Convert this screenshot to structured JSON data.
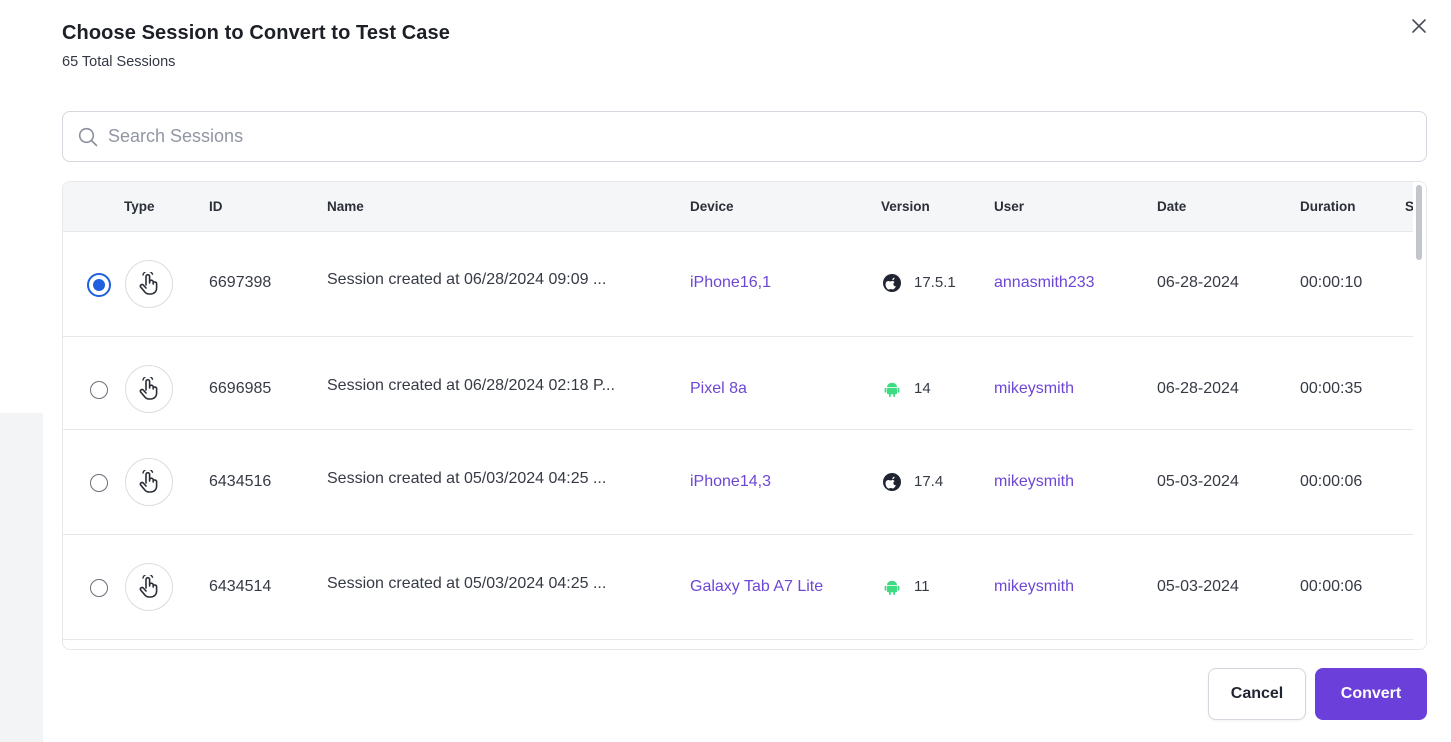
{
  "dialog": {
    "title": "Choose Session to Convert to Test Case",
    "subtitle": "65 Total Sessions"
  },
  "search": {
    "placeholder": "Search Sessions",
    "value": ""
  },
  "table": {
    "columns": [
      "Type",
      "ID",
      "Name",
      "Device",
      "Version",
      "User",
      "Date",
      "Duration",
      "S"
    ],
    "rows": [
      {
        "selected": true,
        "type_icon": "tap-hand-icon",
        "id": "6697398",
        "name": "Session created at 06/28/2024 09:09 ...",
        "device": "iPhone16,1",
        "os": "ios",
        "os_icon": "apple-icon",
        "version": "17.5.1",
        "user": "annasmith233",
        "date": "06-28-2024",
        "duration": "00:00:10"
      },
      {
        "selected": false,
        "type_icon": "tap-hand-icon",
        "id": "6696985",
        "name": "Session created at 06/28/2024 02:18 P...",
        "device": "Pixel 8a",
        "os": "android",
        "os_icon": "android-icon",
        "version": "14",
        "user": "mikeysmith",
        "date": "06-28-2024",
        "duration": "00:00:35"
      },
      {
        "selected": false,
        "type_icon": "tap-hand-icon",
        "id": "6434516",
        "name": "Session created at 05/03/2024 04:25 ...",
        "device": "iPhone14,3",
        "os": "ios",
        "os_icon": "apple-icon",
        "version": "17.4",
        "user": "mikeysmith",
        "date": "05-03-2024",
        "duration": "00:00:06"
      },
      {
        "selected": false,
        "type_icon": "tap-hand-icon",
        "id": "6434514",
        "name": "Session created at 05/03/2024 04:25 ...",
        "device": "Galaxy Tab A7 Lite",
        "os": "android",
        "os_icon": "android-icon",
        "version": "11",
        "user": "mikeysmith",
        "date": "05-03-2024",
        "duration": "00:00:06"
      }
    ]
  },
  "actions": {
    "cancel_label": "Cancel",
    "convert_label": "Convert"
  },
  "colors": {
    "accent": "#6b3fd9",
    "link": "#6d46d6",
    "radio_selected": "#1f5fe0",
    "android": "#3ddc84"
  }
}
